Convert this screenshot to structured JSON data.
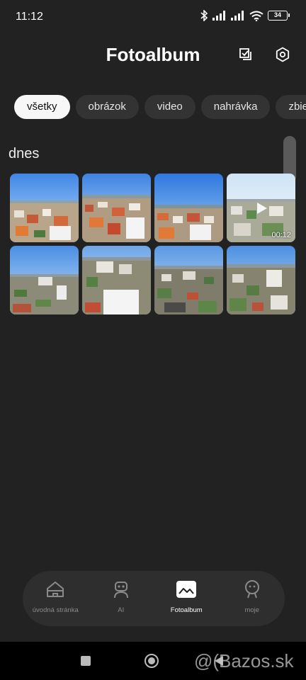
{
  "status_bar": {
    "time": "11:12",
    "battery": "34",
    "icons": [
      "bluetooth-icon",
      "signal-icon",
      "signal-icon",
      "wifi-icon",
      "battery-icon"
    ]
  },
  "header": {
    "title": "Fotoalbum",
    "select_icon": "select-check-icon",
    "settings_icon": "gear-icon"
  },
  "filters": [
    "všetky",
    "obrázok",
    "video",
    "nahrávka",
    "zbie"
  ],
  "active_filter": "všetky",
  "section": {
    "title": "dnes"
  },
  "photos": [
    {
      "kind": "photo"
    },
    {
      "kind": "photo"
    },
    {
      "kind": "photo"
    },
    {
      "kind": "video",
      "duration": "00:12"
    },
    {
      "kind": "photo"
    },
    {
      "kind": "photo"
    },
    {
      "kind": "photo"
    },
    {
      "kind": "photo"
    }
  ],
  "bottom_nav": {
    "items": [
      {
        "label": "úvodná stránka",
        "icon": "home-icon"
      },
      {
        "label": "AI",
        "icon": "robot-icon"
      },
      {
        "label": "Fotoalbum",
        "icon": "photo-album-icon",
        "active": true
      },
      {
        "label": "moje",
        "icon": "profile-icon"
      }
    ]
  },
  "watermark": "@(Bazos.sk",
  "colors": {
    "background": "#222222",
    "chip_inactive": "#333333",
    "chip_active": "#f7f7f7",
    "nav_background": "#2e2e2e",
    "label_inactive": "#8a8a8a"
  }
}
